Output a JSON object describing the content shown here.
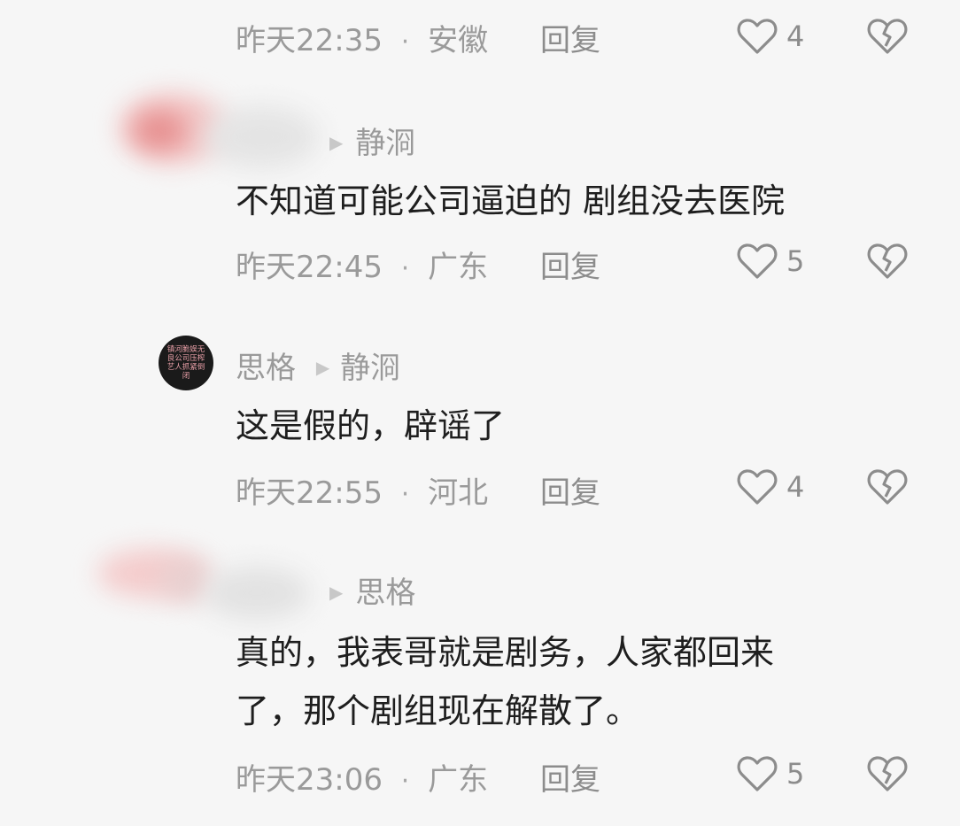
{
  "comments": [
    {
      "time": "昨天22:35",
      "location": "安徽",
      "reply_label": "回复",
      "likes": "4"
    },
    {
      "reply_arrow": "▶",
      "reply_to": "静浻",
      "text": "不知道可能公司逼迫的 剧组没去医院",
      "time": "昨天22:45",
      "location": "广东",
      "reply_label": "回复",
      "likes": "5"
    },
    {
      "author": "思格",
      "reply_arrow": "▶",
      "reply_to": "静浻",
      "avatar_text": "镇河脆娱无良公司压榨艺人抓紧倒闭",
      "text": "这是假的，辟谣了",
      "time": "昨天22:55",
      "location": "河北",
      "reply_label": "回复",
      "likes": "4"
    },
    {
      "reply_arrow": "▶",
      "reply_to": "思格",
      "text_line1": "真的，我表哥就是剧务，人家都回来",
      "text_line2": "了，那个剧组现在解散了。",
      "time": "昨天23:06",
      "location": "广东",
      "reply_label": "回复",
      "likes": "5"
    }
  ],
  "separator": "·",
  "icons": {
    "like": "heart-outline-icon",
    "dislike": "broken-heart-icon"
  }
}
